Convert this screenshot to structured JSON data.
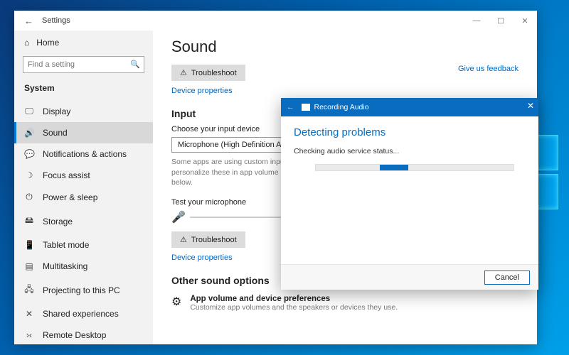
{
  "desktop": {
    "logo_color": "#3cd4ff"
  },
  "window": {
    "title": "Settings",
    "back_glyph": "←",
    "controls": {
      "min": "—",
      "max": "☐",
      "close": "✕"
    }
  },
  "sidebar": {
    "home_label": "Home",
    "home_icon": "⌂",
    "search_placeholder": "Find a setting",
    "search_icon": "🔍",
    "section_label": "System",
    "items": [
      {
        "icon": "🖵",
        "label": "Display"
      },
      {
        "icon": "🔊",
        "label": "Sound",
        "selected": true
      },
      {
        "icon": "💬",
        "label": "Notifications & actions"
      },
      {
        "icon": "☽",
        "label": "Focus assist"
      },
      {
        "icon": "⏻",
        "label": "Power & sleep"
      },
      {
        "icon": "🖴",
        "label": "Storage"
      },
      {
        "icon": "📱",
        "label": "Tablet mode"
      },
      {
        "icon": "▤",
        "label": "Multitasking"
      },
      {
        "icon": "🖧",
        "label": "Projecting to this PC"
      },
      {
        "icon": "✕",
        "label": "Shared experiences"
      },
      {
        "icon": "›‹",
        "label": "Remote Desktop"
      }
    ]
  },
  "content": {
    "heading": "Sound",
    "troubleshoot_label": "Troubleshoot",
    "troubleshoot_icon": "⚠",
    "device_properties_label": "Device properties",
    "feedback_link": "Give us feedback",
    "input_heading": "Input",
    "choose_input_label": "Choose your input device",
    "input_device": "Microphone (High Definition Audio D",
    "custom_apps_note": "Some apps are using custom input settings. You can personalize these in app volume and device preferences below.",
    "test_mic_label": "Test your microphone",
    "mic_icon": "🎤",
    "other_heading": "Other sound options",
    "other_icon": "⚙",
    "other_title": "App volume and device preferences",
    "other_sub": "Customize app volumes and the speakers or devices they use."
  },
  "troubleshooter": {
    "back_glyph": "←",
    "title": "Recording Audio",
    "close_glyph": "✕",
    "heading": "Detecting problems",
    "status": "Checking audio service status...",
    "cancel_label": "Cancel"
  }
}
